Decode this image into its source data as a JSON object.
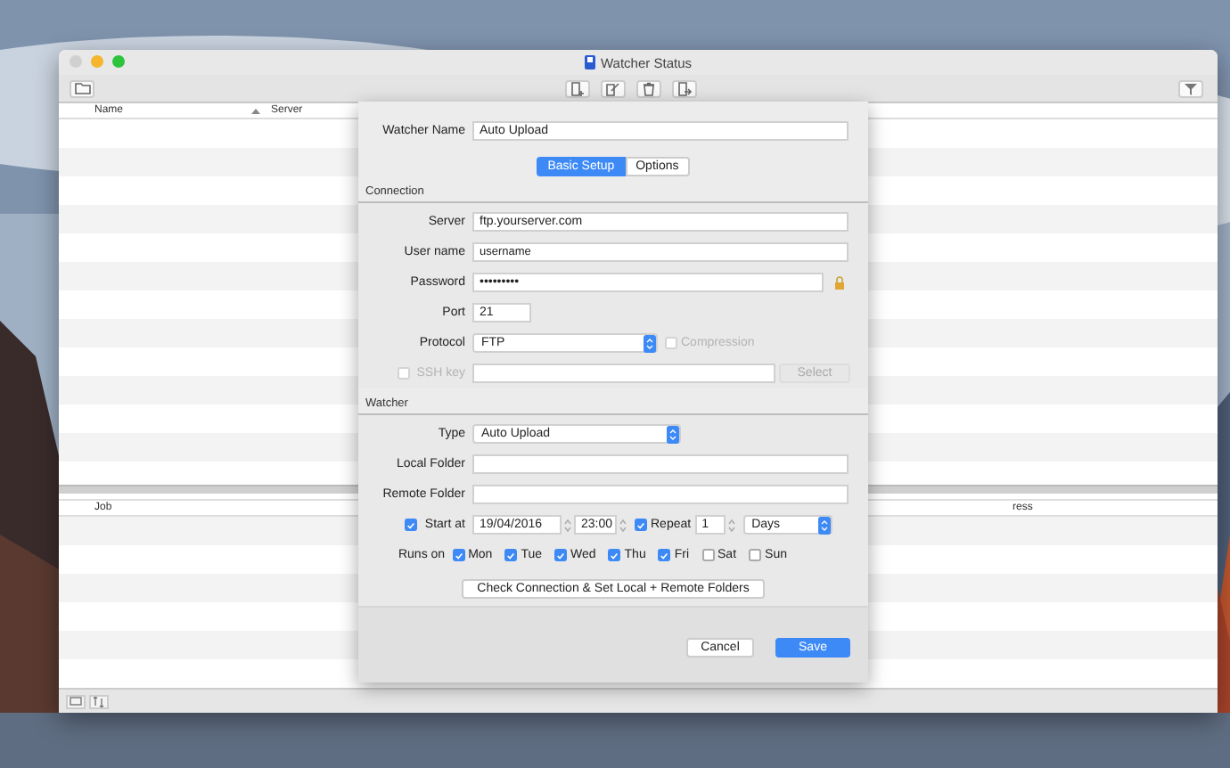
{
  "window": {
    "title": "Watcher Status"
  },
  "upper_table": {
    "columns": [
      "Name",
      "Server"
    ]
  },
  "lower_table": {
    "columns": [
      "Job",
      "ress"
    ]
  },
  "sheet": {
    "watcher_name": {
      "label": "Watcher Name",
      "value": "Auto Upload"
    },
    "tabs": [
      {
        "label": "Basic Setup",
        "selected": true
      },
      {
        "label": "Options",
        "selected": false
      }
    ],
    "connection": {
      "heading": "Connection",
      "server": {
        "label": "Server",
        "value": "ftp.yourserver.com"
      },
      "user_name": {
        "label": "User name",
        "value": "username"
      },
      "password": {
        "label": "Password",
        "value": "•••••••••"
      },
      "port": {
        "label": "Port",
        "value": "21"
      },
      "protocol": {
        "label": "Protocol",
        "value": "FTP"
      },
      "compression": {
        "label": "Compression",
        "checked": false,
        "disabled": true
      },
      "ssh_key": {
        "label": "SSH key",
        "checked": false,
        "disabled": true,
        "button": "Select"
      }
    },
    "watcher": {
      "heading": "Watcher",
      "type": {
        "label": "Type",
        "value": "Auto Upload"
      },
      "local_folder": {
        "label": "Local Folder"
      },
      "remote_folder": {
        "label": "Remote Folder"
      },
      "start": {
        "label": "Start at",
        "checked": true,
        "date": "19/04/2016",
        "time": "23:00"
      },
      "repeat": {
        "label": "Repeat",
        "checked": true,
        "value": "1",
        "unit": "Days"
      },
      "runs_on": {
        "label": "Runs on",
        "days": [
          {
            "label": "Mon",
            "checked": true
          },
          {
            "label": "Tue",
            "checked": true
          },
          {
            "label": "Wed",
            "checked": true
          },
          {
            "label": "Thu",
            "checked": true
          },
          {
            "label": "Fri",
            "checked": true
          },
          {
            "label": "Sat",
            "checked": false
          },
          {
            "label": "Sun",
            "checked": false
          }
        ]
      },
      "check_button": "Check Connection & Set Local + Remote Folders"
    },
    "buttons": {
      "cancel": "Cancel",
      "save": "Save"
    }
  }
}
